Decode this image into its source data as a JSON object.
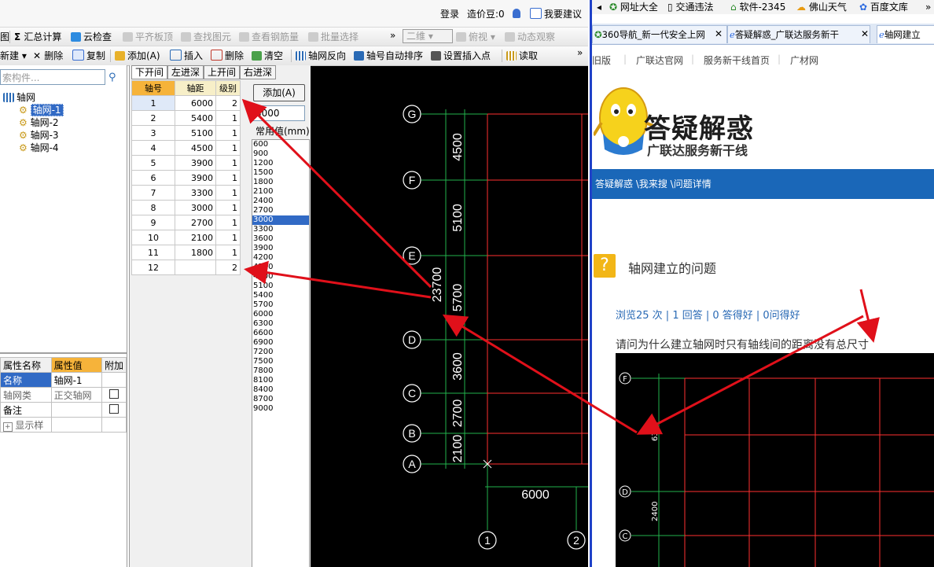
{
  "app": {
    "login_bar": {
      "login": "登录",
      "cost_beans": "造价豆:0",
      "suggest": "我要建议"
    },
    "toolbar1": {
      "summary_calc": "汇总计算",
      "cloud_check": "云检查",
      "flush_slab": "平齐板顶",
      "find_element": "查找图元",
      "view_rebar": "查看钢筋量",
      "batch_select": "批量选择",
      "view_mode": "二维",
      "view": "俯视",
      "dynamic_view": "动态观察"
    },
    "toolbar2": {
      "new": "新建",
      "delete": "删除",
      "copy": "复制",
      "add": "添加(A)",
      "insert": "插入",
      "delete2": "删除",
      "clear": "清空",
      "reverse": "轴网反向",
      "auto_sort": "轴号自动排序",
      "set_insert_point": "设置插入点",
      "read": "读取"
    },
    "tree": {
      "search_placeholder": "索构件...",
      "root": "轴网",
      "items": [
        "轴网-1",
        "轴网-2",
        "轴网-3",
        "轴网-4"
      ]
    },
    "props": {
      "headers": [
        "属性名称",
        "属性值",
        "附加"
      ],
      "rows": [
        {
          "name": "名称",
          "value": "轴网-1"
        },
        {
          "name": "轴网类",
          "value": "正交轴网"
        },
        {
          "name": "备注",
          "value": ""
        },
        {
          "name": "显示样",
          "value": ""
        }
      ]
    },
    "spacing_tabs": [
      "下开间",
      "左进深",
      "上开间",
      "右进深"
    ],
    "axis_table": {
      "headers": [
        "轴号",
        "轴距",
        "级别"
      ],
      "rows": [
        {
          "no": "1",
          "dist": "6000",
          "level": "2"
        },
        {
          "no": "2",
          "dist": "5400",
          "level": "1"
        },
        {
          "no": "3",
          "dist": "5100",
          "level": "1"
        },
        {
          "no": "4",
          "dist": "4500",
          "level": "1"
        },
        {
          "no": "5",
          "dist": "3900",
          "level": "1"
        },
        {
          "no": "6",
          "dist": "3900",
          "level": "1"
        },
        {
          "no": "7",
          "dist": "3300",
          "level": "1"
        },
        {
          "no": "8",
          "dist": "3000",
          "level": "1"
        },
        {
          "no": "9",
          "dist": "2700",
          "level": "1"
        },
        {
          "no": "10",
          "dist": "2100",
          "level": "1"
        },
        {
          "no": "11",
          "dist": "1800",
          "level": "1"
        },
        {
          "no": "12",
          "dist": "",
          "level": "2"
        }
      ]
    },
    "add_button": "添加(A)",
    "value_input": "3000",
    "common_values_label": "常用值(mm)",
    "common_values": [
      "600",
      "900",
      "1200",
      "1500",
      "1800",
      "2100",
      "2400",
      "2700",
      "3000",
      "3300",
      "3600",
      "3900",
      "4200",
      "4500",
      "4800",
      "5100",
      "5400",
      "5700",
      "6000",
      "6300",
      "6600",
      "6900",
      "7200",
      "7500",
      "7800",
      "8100",
      "8400",
      "8700",
      "9000"
    ],
    "selected_common_value": "3000",
    "cad": {
      "axis_labels_v": [
        "G",
        "F",
        "E",
        "D",
        "C",
        "B",
        "A"
      ],
      "dims_v": [
        "4500",
        "5100",
        "5700",
        "3600",
        "2700",
        "2100"
      ],
      "total": "23700",
      "axis_labels_h": [
        "1",
        "2"
      ],
      "dim_h": "6000"
    }
  },
  "browser": {
    "bookmarks": [
      "网址大全",
      "交通违法",
      "软件-2345",
      "佛山天气",
      "百度文库"
    ],
    "more": "»",
    "tabs": [
      "360导航_新一代安全上网",
      "答疑解惑_广联达服务新干",
      "轴网建立"
    ],
    "nav_links": [
      "旧版",
      "广联达官网",
      "服务新干线首页",
      "广材网"
    ],
    "brand_title": "答疑解惑",
    "brand_subtitle": "广联达服务新干线",
    "breadcrumb": "答疑解惑 \\我来搜 \\问题详情",
    "question_title": "轴网建立的问题",
    "stats": "浏览25 次 | 1 回答 | 0 答得好 | 0问得好",
    "question_body": "请问为什么建立轴网时只有轴线间的距离没有总尺寸",
    "embedded": {
      "axis_labels": [
        "F",
        "D",
        "C"
      ],
      "dims": [
        "6300",
        "2400"
      ]
    }
  },
  "colors": {
    "accent_blue": "#1a67b8",
    "selection": "#316ac5",
    "header_orange": "#f6b33a",
    "arrow_red": "#e0101a",
    "grid_red": "#ff3030",
    "grid_green": "#22b24c"
  }
}
